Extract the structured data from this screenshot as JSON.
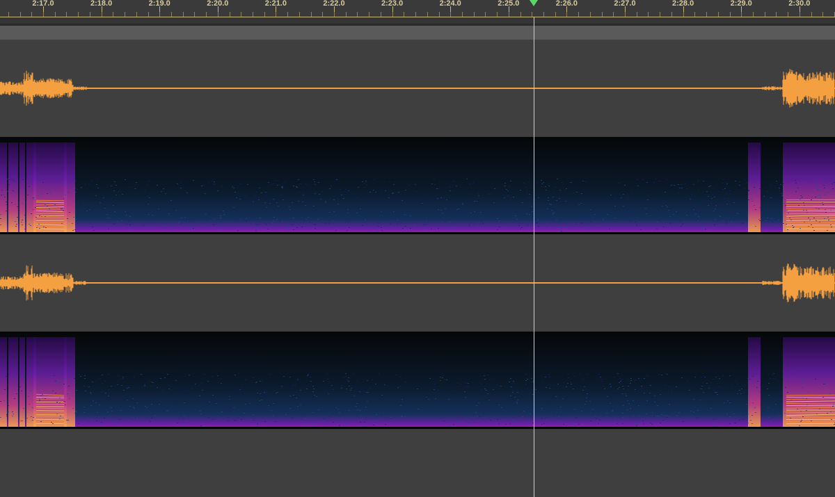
{
  "ruler": {
    "labels": [
      "2:17.0",
      "2:18.0",
      "2:19.0",
      "2:20.0",
      "2:21.0",
      "2:22.0",
      "2:23.0",
      "2:24.0",
      "2:25.0",
      "2:26.0",
      "2:27.0",
      "2:28.0",
      "2:29.0",
      "2:30.0"
    ]
  },
  "colors": {
    "waveform": "#f5a040",
    "ruler_text": "#d9cc99",
    "playhead": "#9ff09a",
    "playhead_marker": "#59d86a",
    "lane_background": "#3f3f3f",
    "spectrogram_background": "#050709"
  },
  "channels": [
    {
      "id": "channel-1"
    },
    {
      "id": "channel-2"
    }
  ],
  "icons": {
    "playhead": "triangle-down-icon"
  }
}
